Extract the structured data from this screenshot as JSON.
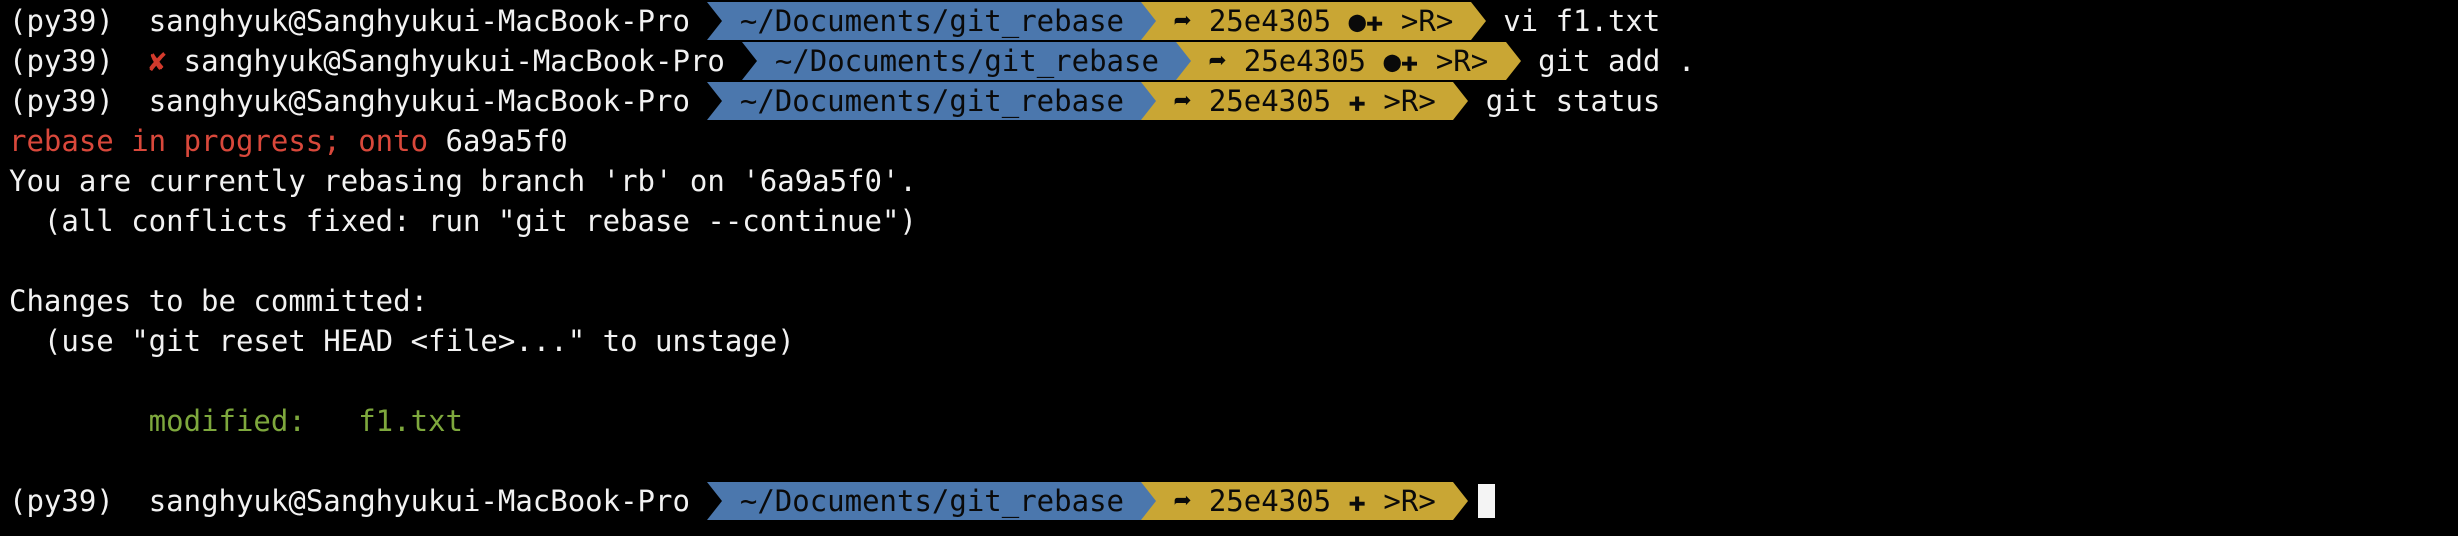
{
  "prompts": [
    {
      "env": "(py39)",
      "error_mark": "",
      "host": "sanghyuk@Sanghyukui-MacBook-Pro",
      "dir": "~/Documents/git_rebase",
      "git": "➦ 25e4305 ●✚ >R>",
      "command": "vi f1.txt"
    },
    {
      "env": "(py39)",
      "error_mark": "✘",
      "host": "sanghyuk@Sanghyukui-MacBook-Pro",
      "dir": "~/Documents/git_rebase",
      "git": "➦ 25e4305 ●✚ >R>",
      "command": "git add ."
    },
    {
      "env": "(py39)",
      "error_mark": "",
      "host": "sanghyuk@Sanghyukui-MacBook-Pro",
      "dir": "~/Documents/git_rebase",
      "git": "➦ 25e4305 ✚ >R>",
      "command": "git status"
    },
    {
      "env": "(py39)",
      "error_mark": "",
      "host": "sanghyuk@Sanghyukui-MacBook-Pro",
      "dir": "~/Documents/git_rebase",
      "git": "➦ 25e4305 ✚ >R>",
      "command": ""
    }
  ],
  "output": {
    "rebase_status": "rebase in progress; onto",
    "rebase_onto": "6a9a5f0",
    "line2": "You are currently rebasing branch 'rb' on '6a9a5f0'.",
    "line3": "  (all conflicts fixed: run \"git rebase --continue\")",
    "line4": "Changes to be committed:",
    "line5": "  (use \"git reset HEAD <file>...\" to unstage)",
    "modified_label": "        modified:   ",
    "modified_file": "f1.txt"
  },
  "colors": {
    "background": "#000000",
    "dir_segment": "#4b77ad",
    "git_segment": "#c9a634",
    "error": "#d33a2c",
    "rebase_text": "#d9483b",
    "modified_text": "#7ea83d"
  }
}
